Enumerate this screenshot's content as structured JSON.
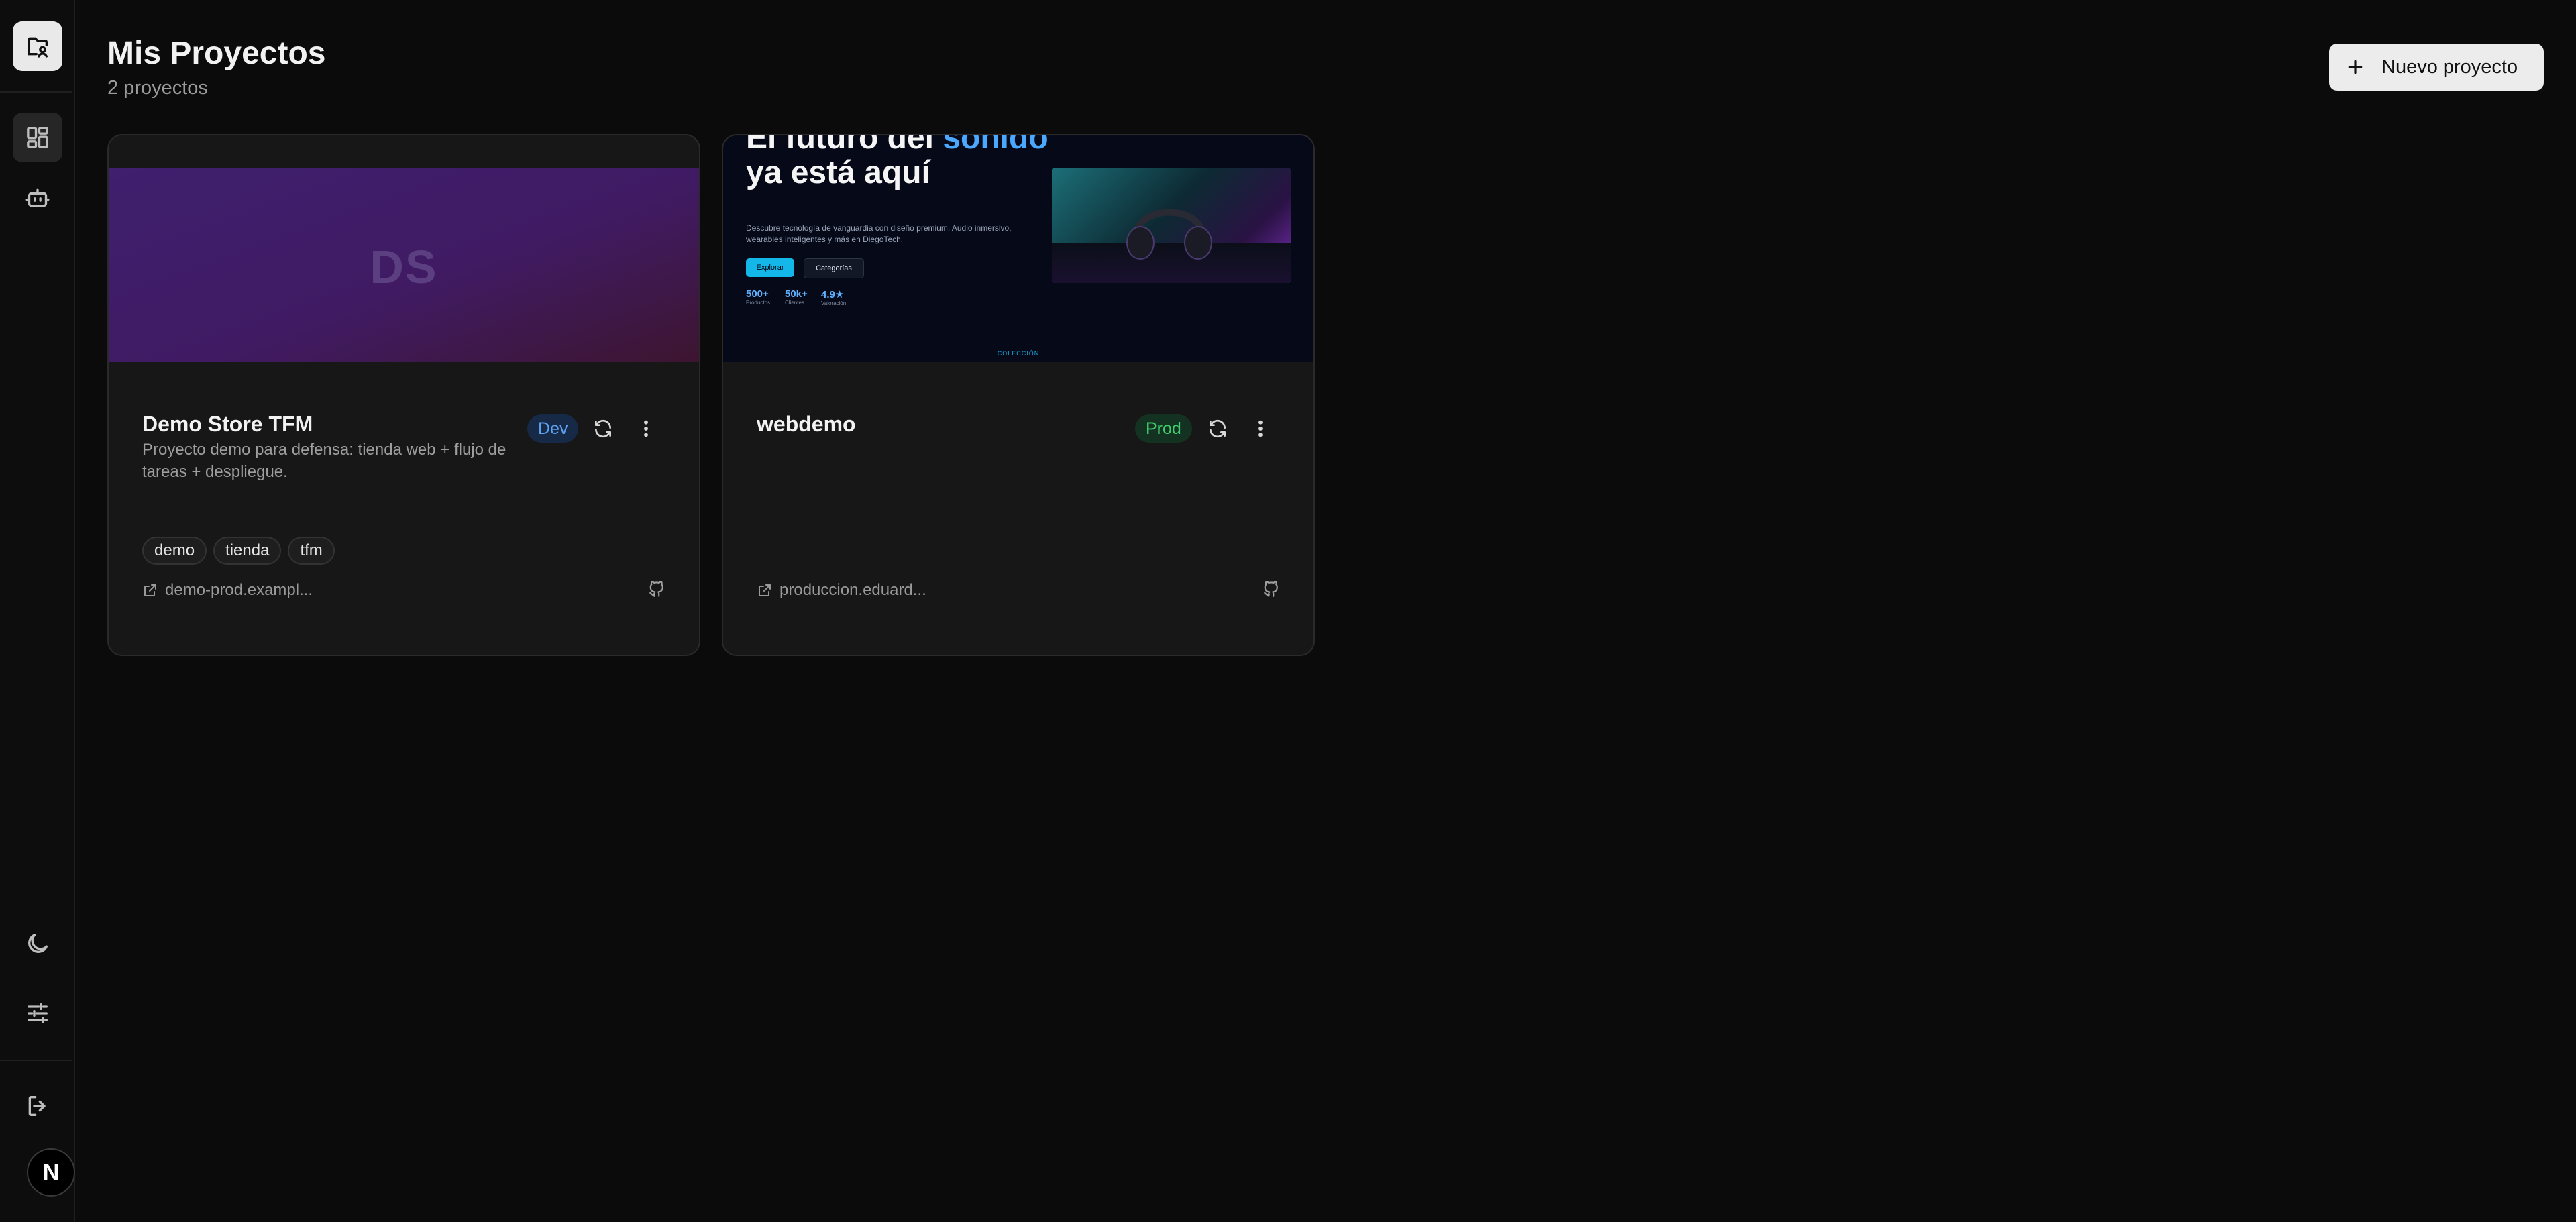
{
  "header": {
    "title": "Mis Proyectos",
    "subtitle": "2 proyectos",
    "new_button_label": "Nuevo proyecto"
  },
  "sidebar": {
    "items": [
      {
        "icon": "folder-user-icon"
      },
      {
        "icon": "dashboard-icon",
        "active": true
      },
      {
        "icon": "bot-icon"
      },
      {
        "icon": "moon-icon"
      },
      {
        "icon": "sliders-icon"
      },
      {
        "icon": "logout-icon"
      }
    ],
    "avatar_initial": "N"
  },
  "projects": [
    {
      "name": "Demo Store TFM",
      "description": "Proyecto demo para defensa: tienda web + flujo de tareas + despliegue.",
      "environment": "Dev",
      "thumbnail_text": "DS",
      "tags": [
        "demo",
        "tienda",
        "tfm"
      ],
      "url": "demo-prod.exampl..."
    },
    {
      "name": "webdemo",
      "description": "",
      "environment": "Prod",
      "tags": [],
      "url": "produccion.eduard...",
      "preview": {
        "title_line1": "El futuro del ",
        "title_accent": "sonido",
        "title_line2": "ya está aquí",
        "description": "Descubre tecnología de vanguardia con diseño premium. Audio inmersivo, wearables inteligentes y más en DiegoTech.",
        "button_primary": "Explorar",
        "button_secondary": "Categorías",
        "stats": [
          {
            "value": "500+",
            "label": "Productos"
          },
          {
            "value": "50k+",
            "label": "Clientes"
          },
          {
            "value": "4.9★",
            "label": "Valoración"
          }
        ],
        "section_label": "COLECCIÓN"
      }
    }
  ],
  "colors": {
    "background": "#0b0b0b",
    "card": "#171717",
    "dev_badge": "#5ea2f2",
    "prod_badge": "#3fcf6d"
  }
}
